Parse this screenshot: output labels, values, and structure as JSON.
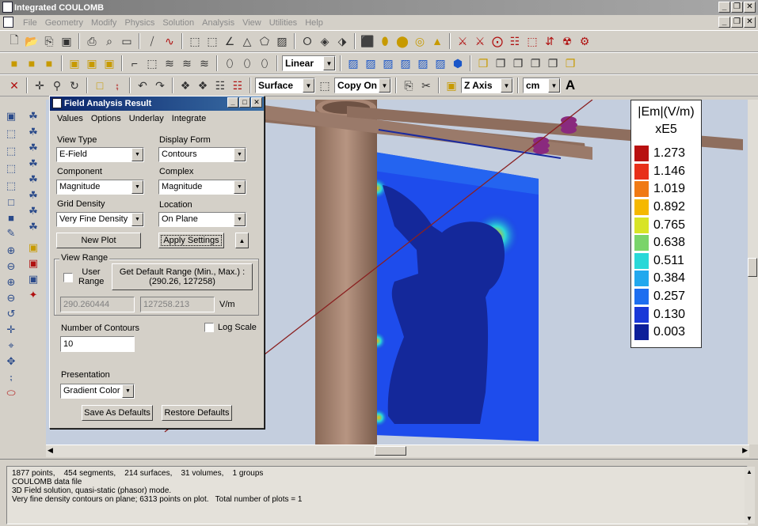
{
  "window": {
    "title": "Integrated COULOMB"
  },
  "menu": [
    "File",
    "Geometry",
    "Modify",
    "Physics",
    "Solution",
    "Analysis",
    "View",
    "Utilities",
    "Help"
  ],
  "toolbar2": {
    "interp_value": "Linear"
  },
  "toolbar3": {
    "surface_value": "Surface",
    "copy_value": "Copy On",
    "axis_value": "Z Axis",
    "unit_value": "cm",
    "text_tool": "A"
  },
  "legend": {
    "title": "|Em|(V/m)",
    "scale": "xE5",
    "entries": [
      {
        "value": "1.273",
        "color": "#b81010"
      },
      {
        "value": "1.146",
        "color": "#e8301a"
      },
      {
        "value": "1.019",
        "color": "#f07a14"
      },
      {
        "value": "0.892",
        "color": "#f5b800"
      },
      {
        "value": "0.765",
        "color": "#d8e426"
      },
      {
        "value": "0.638",
        "color": "#7ad46a"
      },
      {
        "value": "0.511",
        "color": "#2ad8d8"
      },
      {
        "value": "0.384",
        "color": "#22a8ee"
      },
      {
        "value": "0.257",
        "color": "#1e6ef0"
      },
      {
        "value": "0.130",
        "color": "#1a38d8"
      },
      {
        "value": "0.003",
        "color": "#0d1f9a"
      }
    ]
  },
  "dialog": {
    "title": "Field Analysis Result",
    "menu": [
      "Values",
      "Options",
      "Underlay",
      "Integrate"
    ],
    "view_type_label": "View Type",
    "view_type_value": "E-Field",
    "display_form_label": "Display Form",
    "display_form_value": "Contours",
    "component_label": "Component",
    "component_value": "Magnitude",
    "complex_label": "Complex",
    "complex_value": "Magnitude",
    "grid_density_label": "Grid Density",
    "grid_density_value": "Very Fine Density",
    "location_label": "Location",
    "location_value": "On Plane",
    "new_plot_label": "New Plot",
    "apply_settings_label": "Apply Settings",
    "view_range_label": "View Range",
    "user_range_label": "User Range",
    "default_range_label": "Get Default Range (Min., Max.) :",
    "default_range_values": "(290.26, 127258)",
    "range_min": "290.260444",
    "range_max": "127258.213",
    "range_unit": "V/m",
    "num_contours_label": "Number of Contours",
    "num_contours_value": "10",
    "log_scale_label": "Log Scale",
    "presentation_label": "Presentation",
    "presentation_value": "Gradient Color",
    "save_defaults_label": "Save As Defaults",
    "restore_defaults_label": "Restore Defaults"
  },
  "status_log": [
    "1877 points,    454 segments,    214 surfaces,    31 volumes,    1 groups",
    "COULOMB data file",
    "3D Field solution, quasi-static (phasor) mode.",
    "Very fine density contours on plane; 6313 points on plot.   Total number of plots = 1"
  ]
}
